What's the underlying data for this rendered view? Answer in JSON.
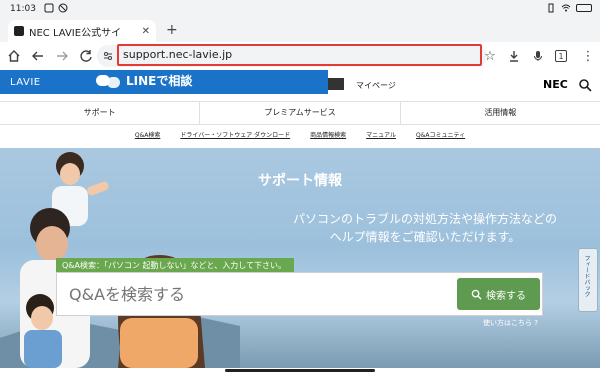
{
  "status_bar": {
    "time": "11:03"
  },
  "browser": {
    "tab_title": "NEC LAVIE公式サイ",
    "url": "support.nec-lavie.jp",
    "tab_count": "1"
  },
  "site_header": {
    "logo": "LAVIE",
    "line_banner": "LINEで相談",
    "mypage": "マイページ",
    "brand": "NEC"
  },
  "main_nav": [
    "サポート",
    "プレミアムサービス",
    "活用情報"
  ],
  "sub_nav": [
    "Q&A検索",
    "ドライバー・ソフトウェア ダウンロード",
    "商品情報検索",
    "マニュアル",
    "Q&Aコミュニティ"
  ],
  "hero": {
    "title": "サポート情報",
    "lead": "パソコンのトラブルの対処方法や操作方法などの\nヘルプ情報をご確認いただけます。",
    "hint": "Q&A検索：「パソコン 起動しない」などと、入力して下さい。",
    "search_placeholder": "Q&Aを検索する",
    "search_button": "検索する",
    "howto": "使い方はこちら ?",
    "feedback": "フィードバック"
  },
  "colors": {
    "accent_blue": "#1a73c9",
    "search_green": "#5e9a4f",
    "url_highlight": "#e53935"
  }
}
